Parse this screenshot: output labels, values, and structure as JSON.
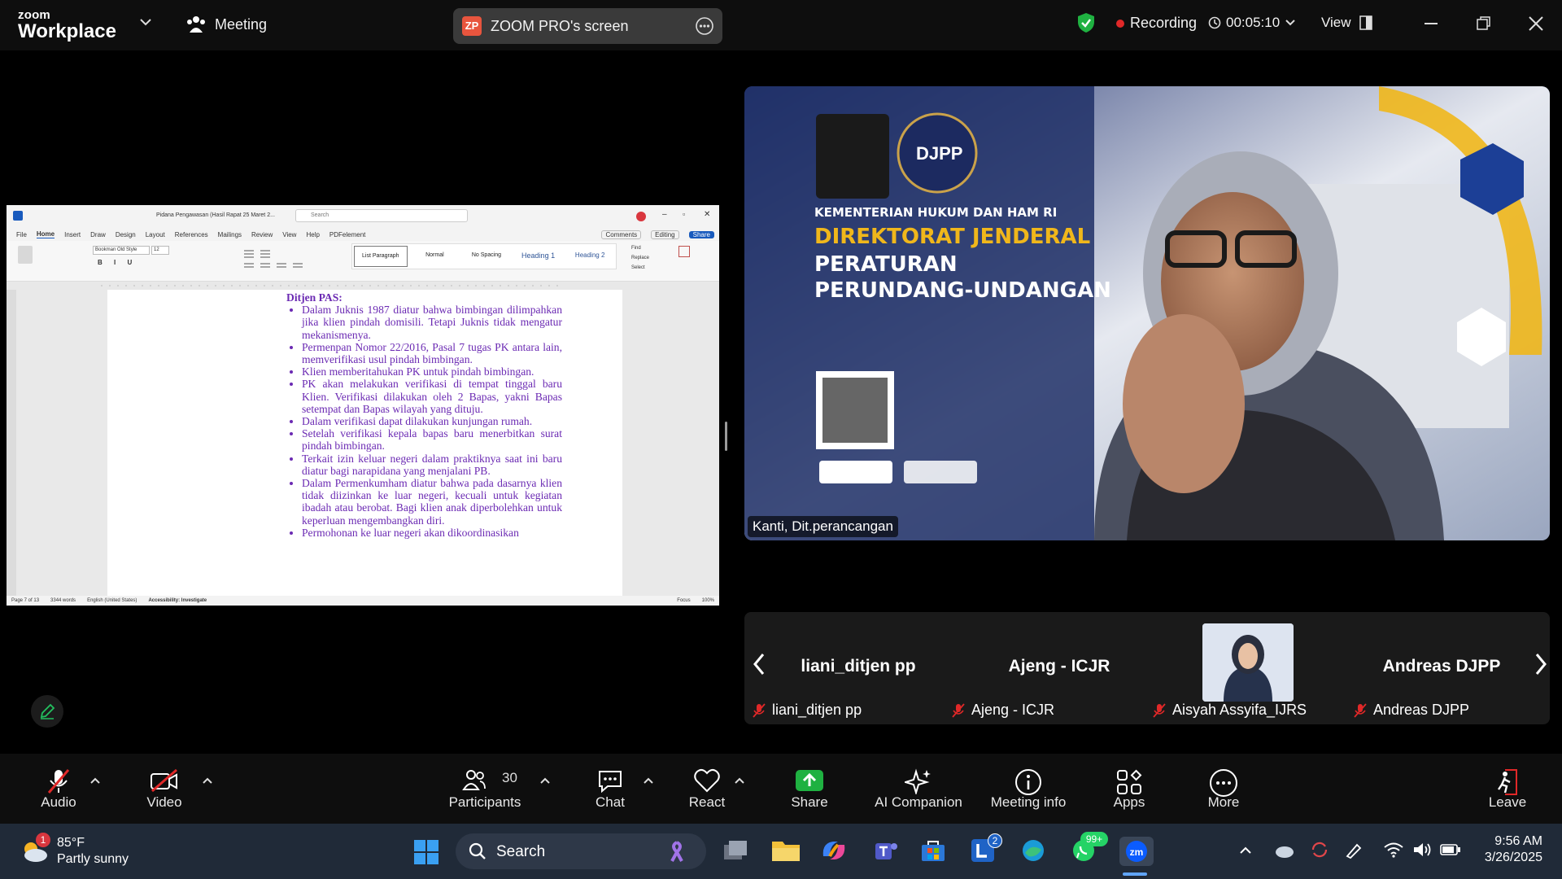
{
  "topbar": {
    "brand_small": "zoom",
    "brand_big": "Workplace",
    "meeting_label": "Meeting",
    "share_badge": "ZP",
    "share_title": "ZOOM PRO's screen",
    "recording_label": "Recording",
    "timer": "00:05:10",
    "view_label": "View"
  },
  "document": {
    "app_title": "Pidana Pengawasan (Hasil Rapat 25 Maret 2...",
    "search_placeholder": "Search",
    "tabs": [
      "File",
      "Home",
      "Insert",
      "Draw",
      "Design",
      "Layout",
      "References",
      "Mailings",
      "Review",
      "View",
      "Help",
      "PDFelement"
    ],
    "font_name": "Bookman Old Style",
    "font_size": "12",
    "styles": [
      "List Paragraph",
      "Normal",
      "No Spacing",
      "Heading 1",
      "Heading 2"
    ],
    "editing_items": [
      "Find",
      "Replace",
      "Select"
    ],
    "comments_label": "Comments",
    "editing_label": "Editing",
    "share_label": "Share",
    "heading": "Ditjen PAS:",
    "bullets": [
      "Dalam Juknis 1987 diatur bahwa bimbingan dilimpahkan jika klien pindah domisili. Tetapi Juknis tidak mengatur mekanismenya.",
      "Permenpan Nomor 22/2016, Pasal 7 tugas PK antara lain, memverifikasi usul pindah bimbingan.",
      "Klien memberitahukan PK untuk pindah bimbingan.",
      "PK akan melakukan verifikasi di tempat tinggal baru Klien. Verifikasi dilakukan oleh 2 Bapas, yakni Bapas setempat dan Bapas wilayah yang dituju.",
      "Dalam verifikasi dapat dilakukan kunjungan rumah.",
      "Setelah verifikasi kepala bapas baru menerbitkan surat pindah bimbingan.",
      "Terkait izin keluar negeri dalam praktiknya saat ini baru diatur bagi narapidana yang menjalani PB.",
      "Dalam Permenkumham diatur bahwa pada dasarnya klien tidak diizinkan ke luar negeri, kecuali untuk kegiatan ibadah atau berobat. Bagi klien anak diperbolehkan untuk keperluan mengembangkan diri.",
      "Permohonan ke luar negeri akan dikoordinasikan"
    ],
    "status_page": "Page 7 of 13",
    "status_words": "3344 words",
    "status_lang": "English (United States)",
    "status_access": "Accessibility: Investigate",
    "status_focus": "Focus",
    "status_zoom": "100%"
  },
  "speaker": {
    "name": "Kanti, Dit.perancangan",
    "bg_lines": [
      "KEMENTERIAN HUKUM DAN HAM RI",
      "DIREKTORAT JENDERAL",
      "PERATURAN",
      "PERUNDANG-UNDANGAN"
    ],
    "logo_text": "DJPP"
  },
  "participants": [
    {
      "tile_name": "liani_ditjen pp",
      "label": "liani_ditjen pp"
    },
    {
      "tile_name": "Ajeng - ICJR",
      "label": "Ajeng - ICJR"
    },
    {
      "tile_name": "",
      "label": "Aisyah Assyifa_IJRS"
    },
    {
      "tile_name": "Andreas DJPP",
      "label": "Andreas DJPP"
    }
  ],
  "controls": {
    "audio": "Audio",
    "video": "Video",
    "participants": "Participants",
    "participants_count": "30",
    "chat": "Chat",
    "react": "React",
    "share": "Share",
    "ai_companion": "AI Companion",
    "meeting_info": "Meeting info",
    "apps": "Apps",
    "more": "More",
    "leave": "Leave"
  },
  "taskbar": {
    "weather_temp": "85°F",
    "weather_desc": "Partly sunny",
    "weather_badge": "1",
    "search_label": "Search",
    "teams_badge": "2",
    "whatsapp_badge": "99+",
    "time": "9:56 AM",
    "date": "3/26/2025"
  },
  "colors": {
    "zoom_blue": "#0b5cff",
    "recording_red": "#e02828",
    "shield_green": "#1fb141",
    "share_green": "#1fb141",
    "leave_red": "#e02828",
    "doc_text_purple": "#6b2ab3"
  }
}
